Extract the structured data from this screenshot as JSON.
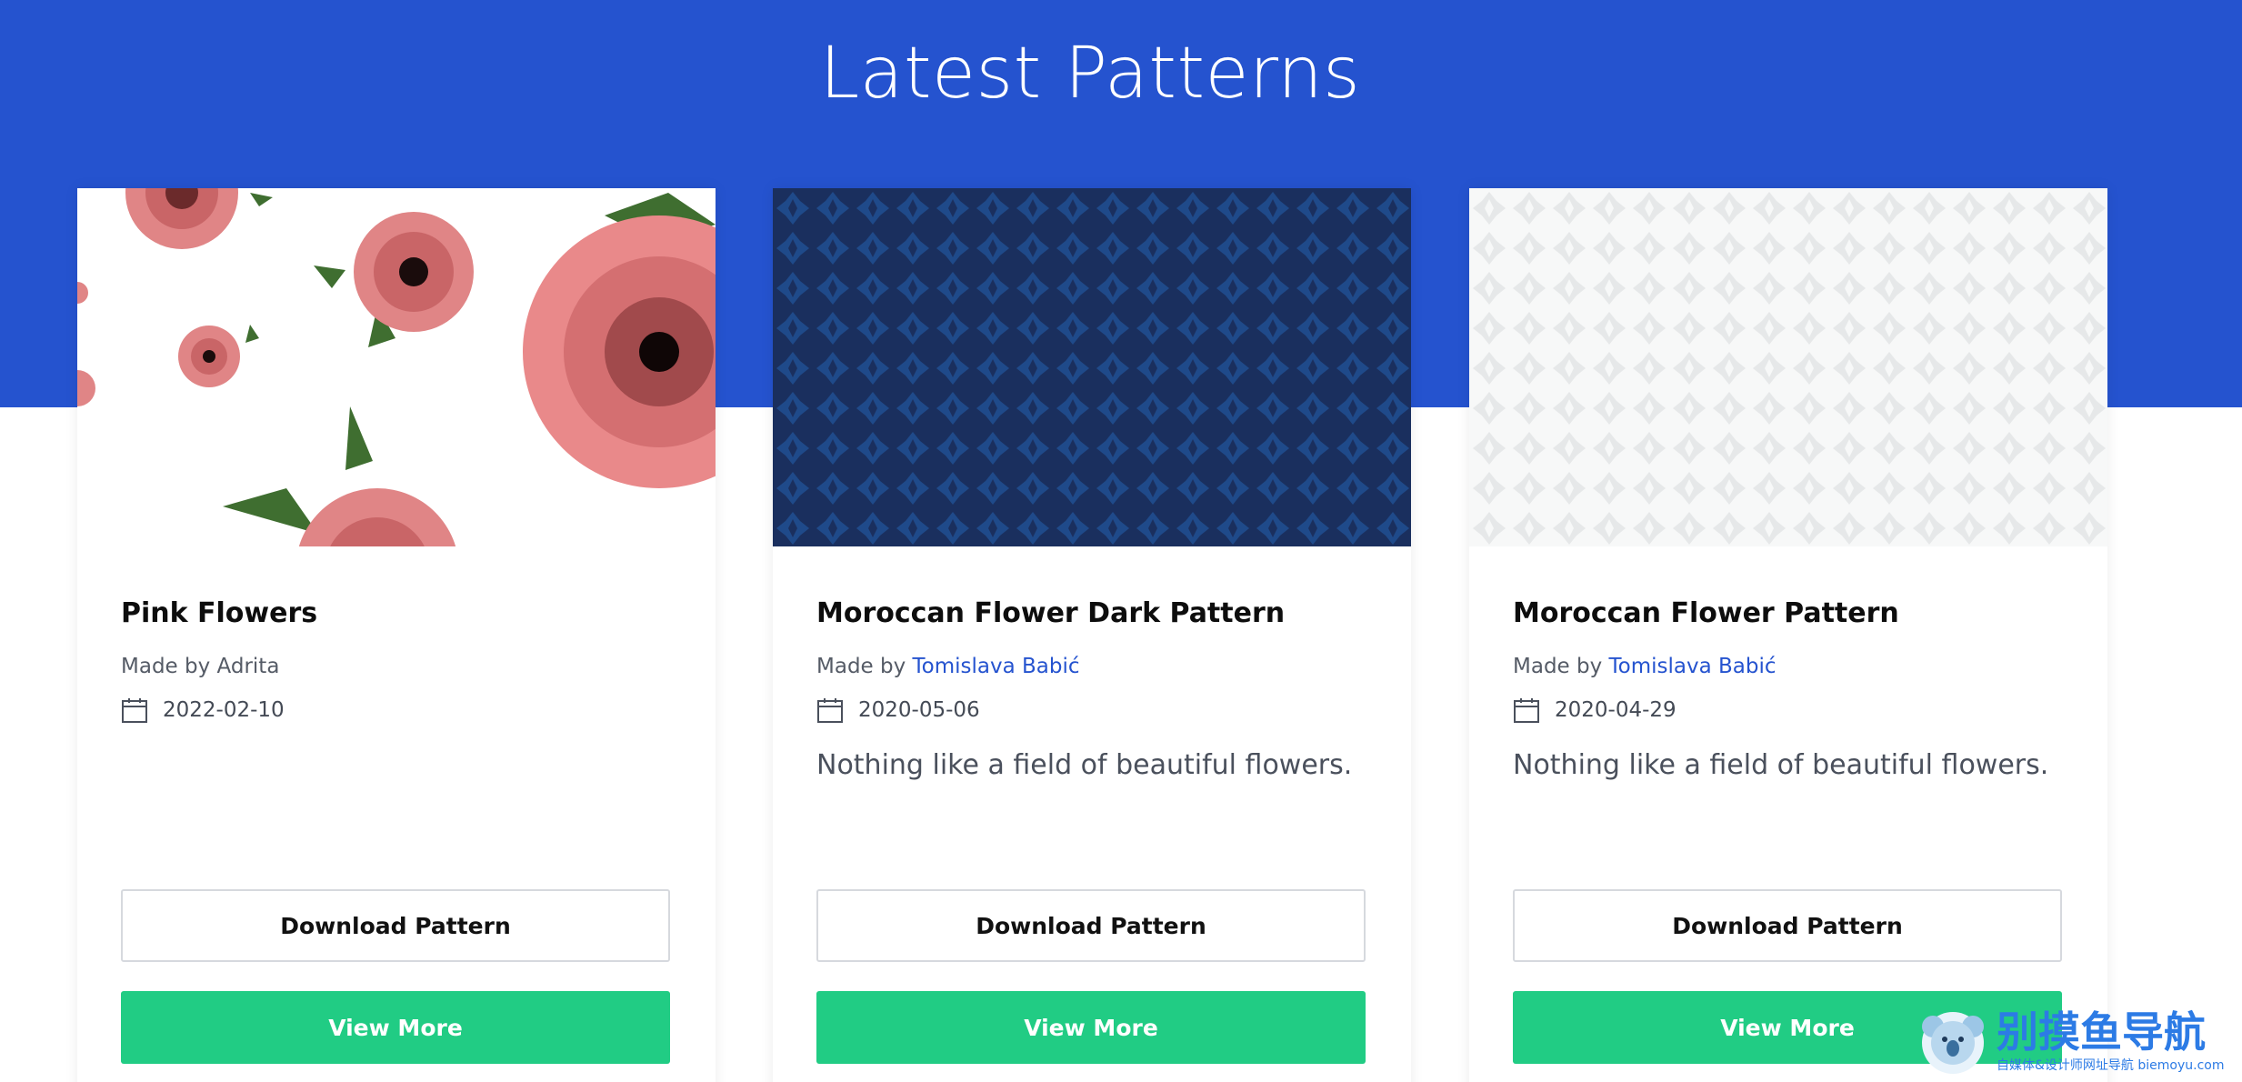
{
  "header": {
    "title": "Latest Patterns",
    "background": "#2553cf"
  },
  "cards": [
    {
      "title": "Pink Flowers",
      "made_by_prefix": "Made by ",
      "author": "Adrita",
      "author_is_link": false,
      "date": "2022-02-10",
      "description": "",
      "download_label": "Download Pattern",
      "view_label": "View More",
      "thumbnail": "pink-flowers-pattern"
    },
    {
      "title": "Moroccan Flower Dark Pattern",
      "made_by_prefix": "Made by ",
      "author": "Tomislava Babić",
      "author_is_link": true,
      "date": "2020-05-06",
      "description": "Nothing like a field of beautiful flowers.",
      "download_label": "Download Pattern",
      "view_label": "View More",
      "thumbnail": "moroccan-dark-pattern"
    },
    {
      "title": "Moroccan Flower Pattern",
      "made_by_prefix": "Made by ",
      "author": "Tomislava Babić",
      "author_is_link": true,
      "date": "2020-04-29",
      "description": "Nothing like a field of beautiful flowers.",
      "download_label": "Download Pattern",
      "view_label": "View More",
      "thumbnail": "moroccan-light-pattern"
    }
  ],
  "colors": {
    "accent": "#2553cf",
    "view_button": "#21cc84",
    "link": "#2553cf"
  },
  "watermark": {
    "title": "别摸鱼导航",
    "subtitle": "自媒体&设计师网址导航 biemoyu.com"
  }
}
